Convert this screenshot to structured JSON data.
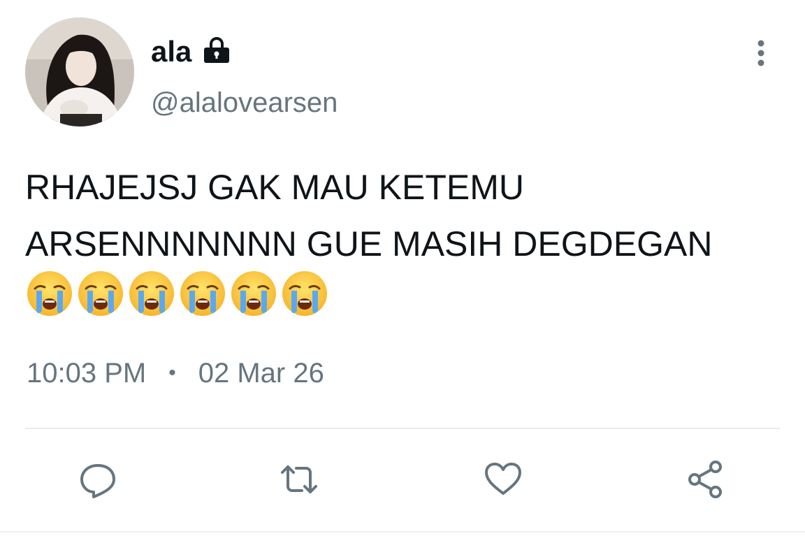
{
  "user": {
    "display_name": "ala",
    "handle": "@alalovearsen",
    "protected_icon": "lock-icon",
    "avatar": "profile-photo"
  },
  "tweet": {
    "text_lines": [
      "RHAJEJSJ GAK MAU KETEMU",
      "ARSENNNNNNN GUE MASIH DEGDEGAN"
    ],
    "emoji": "😭",
    "emoji_count": 6,
    "time": "10:03 PM",
    "separator": "•",
    "date": "02 Mar 26"
  },
  "actions": {
    "reply_icon": "reply-icon",
    "retweet_icon": "retweet-icon",
    "like_icon": "heart-icon",
    "share_icon": "share-icon",
    "more_icon": "more-vertical-icon"
  },
  "colors": {
    "text": "#0f1419",
    "secondary": "#66757f",
    "divider": "#e6ecf0"
  }
}
